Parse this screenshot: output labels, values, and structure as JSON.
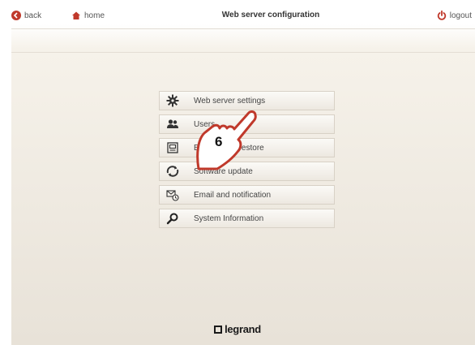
{
  "header": {
    "back_label": "back",
    "home_label": "home",
    "title": "Web server configuration",
    "logout_label": "logout"
  },
  "menu": {
    "items": [
      {
        "label": "Web server settings",
        "icon": "gear-icon"
      },
      {
        "label": "Users",
        "icon": "users-icon"
      },
      {
        "label": "Backup and restore",
        "icon": "backup-icon"
      },
      {
        "label": "Software update",
        "icon": "update-icon"
      },
      {
        "label": "Email and notification",
        "icon": "email-icon"
      },
      {
        "label": "System Information",
        "icon": "search-icon"
      }
    ]
  },
  "annotation": {
    "step_number": "6"
  },
  "footer": {
    "brand": "legrand"
  },
  "colors": {
    "accent": "#c0392b",
    "text": "#444444",
    "button_border": "#d8d1c6"
  }
}
